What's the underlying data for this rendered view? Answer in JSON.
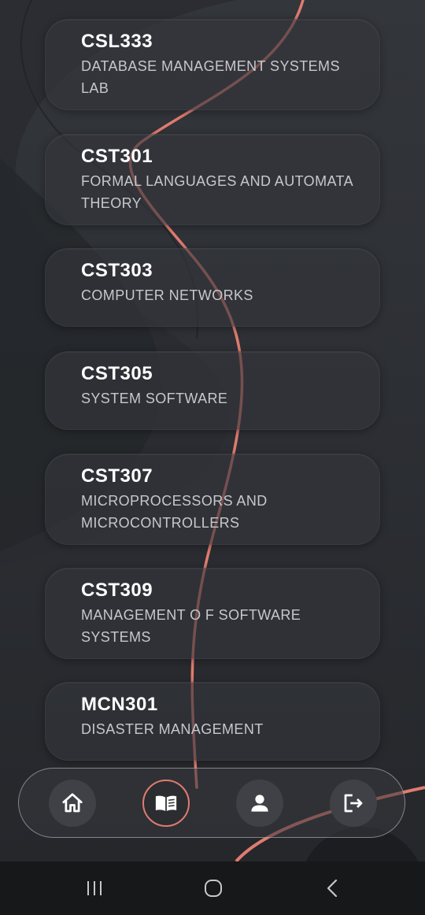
{
  "courses": [
    {
      "code": "CSL333",
      "name": "DATABASE MANAGEMENT SYSTEMS LAB"
    },
    {
      "code": "CST301",
      "name": "FORMAL LANGUAGES AND AUTOMATA THEORY"
    },
    {
      "code": "CST303",
      "name": "COMPUTER NETWORKS"
    },
    {
      "code": "CST305",
      "name": "SYSTEM SOFTWARE"
    },
    {
      "code": "CST307",
      "name": "MICROPROCESSORS AND MICROCONTROLLERS"
    },
    {
      "code": "CST309",
      "name": "MANAGEMENT O F SOFTWARE SYSTEMS"
    },
    {
      "code": "MCN301",
      "name": "DISASTER MANAGEMENT"
    }
  ],
  "bottom_nav": {
    "items": [
      {
        "icon": "home-icon",
        "active": false
      },
      {
        "icon": "book-icon",
        "active": true
      },
      {
        "icon": "person-icon",
        "active": false
      },
      {
        "icon": "logout-icon",
        "active": false
      }
    ]
  },
  "system_nav": {
    "items": [
      "recent-apps-icon",
      "home-circle-icon",
      "back-icon"
    ]
  },
  "colors": {
    "background": "#26282c",
    "card": "#34363b",
    "accent": "#e07b70",
    "text_primary": "#ffffff",
    "text_secondary": "#c6c8cc"
  }
}
